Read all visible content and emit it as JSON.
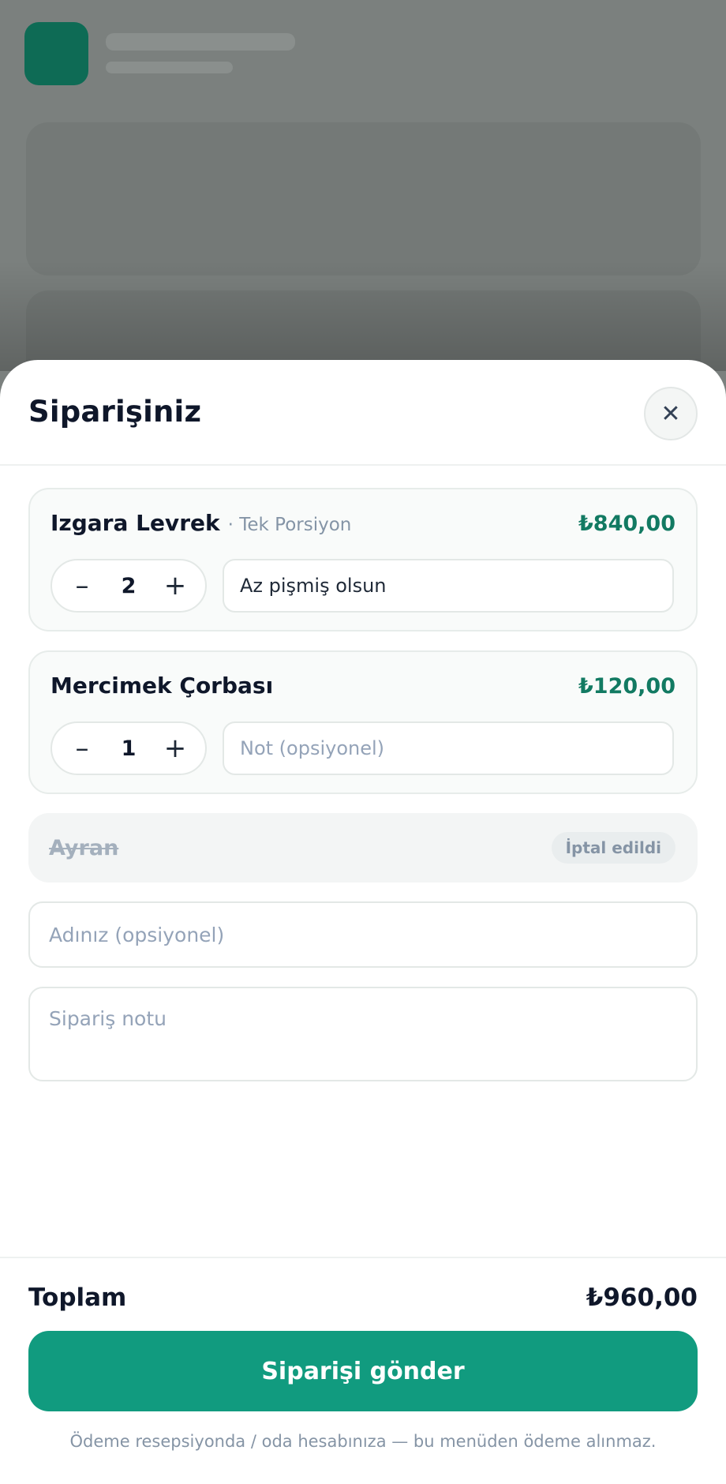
{
  "sheet": {
    "title": "Siparişiniz",
    "close_icon": "close-icon",
    "close_glyph": "✕"
  },
  "items": [
    {
      "name": "Izgara Levrek",
      "variant": "· Tek Porsiyon",
      "price": "₺840,00",
      "quantity": "2",
      "note_value": "Az pişmiş olsun",
      "note_placeholder": "Not (opsiyonel)"
    },
    {
      "name": "Mercimek Çorbası",
      "variant": "",
      "price": "₺120,00",
      "quantity": "1",
      "note_value": "",
      "note_placeholder": "Not (opsiyonel)"
    }
  ],
  "stepper": {
    "minus_glyph": "–",
    "plus_glyph": "+"
  },
  "cancelled_item": {
    "name": "Ayran",
    "badge": "İptal edildi"
  },
  "form": {
    "name_placeholder": "Adınız (opsiyonel)",
    "name_value": "",
    "order_note_placeholder": "Sipariş notu",
    "order_note_value": ""
  },
  "footer": {
    "total_label": "Toplam",
    "total_value": "₺960,00",
    "submit_label": "Siparişi gönder",
    "payment_note": "Ödeme resepsiyonda / oda hesabınıza — bu menüden ödeme alınmaz."
  },
  "colors": {
    "accent": "#119b7f",
    "price": "#127a62",
    "overlay": "#7b807e"
  }
}
